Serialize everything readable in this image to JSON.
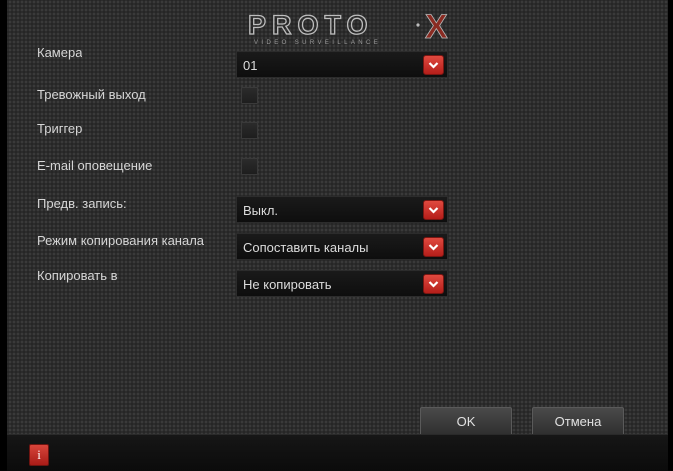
{
  "logo": {
    "brand": "PROTO",
    "mark": "X",
    "tagline": "VIDEO SURVEILLANCE"
  },
  "form": {
    "camera": {
      "label": "Камера",
      "value": "01"
    },
    "alarm_output": {
      "label": "Тревожный выход",
      "checked": false
    },
    "trigger": {
      "label": "Триггер",
      "checked": false
    },
    "email_alert": {
      "label": "E-mail оповещение",
      "checked": false
    },
    "pre_record": {
      "label": "Предв. запись:",
      "value": "Выкл."
    },
    "copy_mode": {
      "label": "Режим копирования канала",
      "value": "Сопоставить каналы"
    },
    "copy_to": {
      "label": "Копировать в",
      "value": "Не копировать"
    }
  },
  "buttons": {
    "ok": "OK",
    "cancel": "Отмена"
  },
  "status_bar": {
    "info_icon": "info-icon",
    "info_glyph": "i"
  },
  "colors": {
    "accent": "#c62a22",
    "background": "#1c1c1c",
    "text": "#d6d6d6"
  }
}
